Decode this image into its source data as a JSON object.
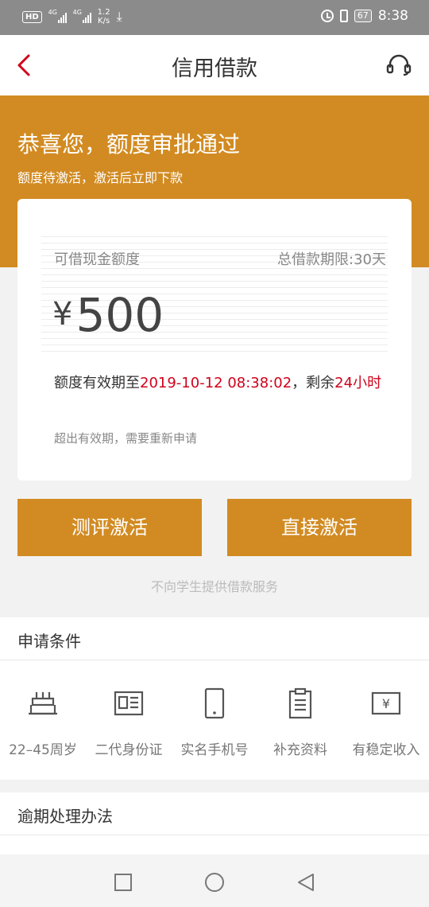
{
  "status_bar": {
    "hd": "HD",
    "signal_1": "4G",
    "signal_2": "4G",
    "speed_value": "1.2",
    "speed_unit": "K/s",
    "battery": "67",
    "time": "8:38"
  },
  "header": {
    "title": "信用借款",
    "back_icon": "chevron-left-icon",
    "support_icon": "headset-icon",
    "accent_color": "#d0021b"
  },
  "banner": {
    "title": "恭喜您，额度审批通过",
    "subtitle": "额度待激活，激活后立即下款",
    "color": "#d28b22"
  },
  "credit_card": {
    "label": "可借现金额度",
    "term": "总借款期限:30天",
    "currency": "¥",
    "amount": "500",
    "validity_prefix": "额度有效期至",
    "validity_date": "2019-10-12 08:38:02",
    "validity_mid": "，剩余",
    "validity_remaining": "24小时",
    "note": "超出有效期，需要重新申请"
  },
  "buttons": {
    "evaluate": "测评激活",
    "direct": "直接激活"
  },
  "notice": "不向学生提供借款服务",
  "conditions": {
    "title": "申请条件",
    "items": [
      {
        "label": "22–45周岁",
        "icon": "birthday-cake-icon"
      },
      {
        "label": "二代身份证",
        "icon": "id-card-icon"
      },
      {
        "label": "实名手机号",
        "icon": "phone-icon"
      },
      {
        "label": "补充资料",
        "icon": "clipboard-icon"
      },
      {
        "label": "有稳定收入",
        "icon": "income-icon"
      }
    ]
  },
  "overdue": {
    "title": "逾期处理办法"
  },
  "nav_bar": {
    "recent_icon": "square-icon",
    "home_icon": "circle-icon",
    "back_icon": "triangle-back-icon"
  }
}
